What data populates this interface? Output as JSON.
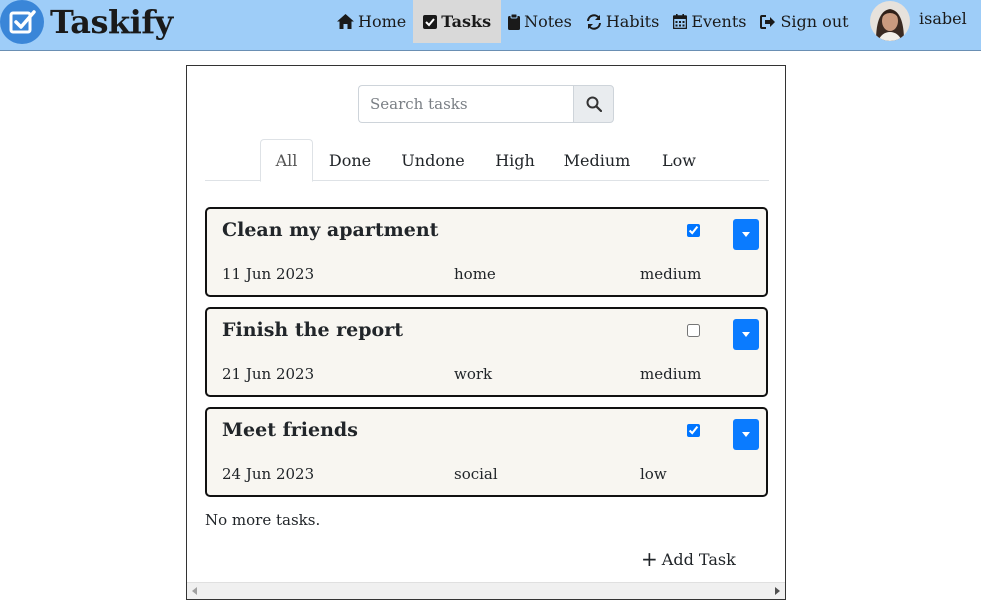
{
  "brand": {
    "name": "Taskify"
  },
  "nav": {
    "items": [
      {
        "label": "Home",
        "icon": "home-icon"
      },
      {
        "label": "Tasks",
        "icon": "check-square-icon",
        "active": true
      },
      {
        "label": "Notes",
        "icon": "clipboard-icon"
      },
      {
        "label": "Habits",
        "icon": "repeat-icon"
      },
      {
        "label": "Events",
        "icon": "calendar-icon"
      },
      {
        "label": "Sign out",
        "icon": "sign-out-icon"
      }
    ]
  },
  "user": {
    "name": "isabel"
  },
  "search": {
    "placeholder": "Search tasks",
    "value": ""
  },
  "tabs": [
    "All",
    "Done",
    "Undone",
    "High",
    "Medium",
    "Low"
  ],
  "tasks": [
    {
      "title": "Clean my apartment",
      "date": "11 Jun 2023",
      "category": "home",
      "priority": "medium",
      "done": true
    },
    {
      "title": "Finish the report",
      "date": "21 Jun 2023",
      "category": "work",
      "priority": "medium",
      "done": false
    },
    {
      "title": "Meet friends",
      "date": "24 Jun 2023",
      "category": "social",
      "priority": "low",
      "done": true
    }
  ],
  "footer": {
    "no_more": "No more tasks.",
    "add_task": "Add Task"
  },
  "colors": {
    "navbar": "#9ecdf8",
    "accent": "#0a7bff",
    "card_bg": "#f8f6f1"
  }
}
